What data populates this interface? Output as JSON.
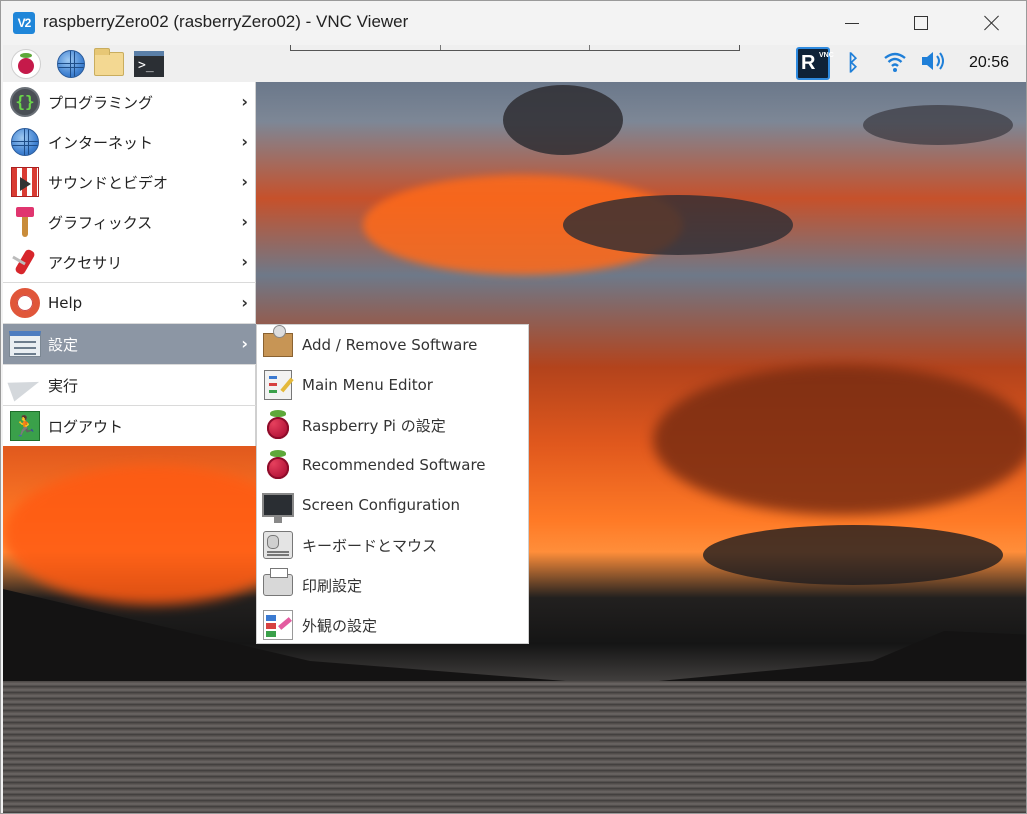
{
  "window": {
    "title": "raspberryZero02 (rasberryZero02) - VNC Viewer",
    "app_icon_text": "V2"
  },
  "taskbar": {
    "clock": "20:56",
    "vnc_tray_letter": "R",
    "vnc_tray_small": "VNC",
    "icons": [
      "raspberry-menu-icon",
      "web-browser-icon",
      "file-manager-icon",
      "terminal-icon"
    ],
    "terminal_glyph": ">_"
  },
  "menu": {
    "items": [
      {
        "label": "プログラミング",
        "icon": "programming-icon",
        "has_submenu": true
      },
      {
        "label": "インターネット",
        "icon": "internet-icon",
        "has_submenu": true
      },
      {
        "label": "サウンドとビデオ",
        "icon": "sound-video-icon",
        "has_submenu": true
      },
      {
        "label": "グラフィックス",
        "icon": "graphics-icon",
        "has_submenu": true
      },
      {
        "label": "アクセサリ",
        "icon": "accessories-icon",
        "has_submenu": true
      },
      {
        "label": "Help",
        "icon": "help-icon",
        "has_submenu": true
      },
      {
        "label": "設定",
        "icon": "settings-icon",
        "has_submenu": true,
        "active": true
      },
      {
        "label": "実行",
        "icon": "run-icon",
        "has_submenu": false
      },
      {
        "label": "ログアウト",
        "icon": "logout-icon",
        "has_submenu": false
      }
    ],
    "arrow": "›"
  },
  "submenu": {
    "items": [
      {
        "label": "Add / Remove Software",
        "icon": "package-icon"
      },
      {
        "label": "Main Menu Editor",
        "icon": "menu-editor-icon"
      },
      {
        "label": "Raspberry Pi の設定",
        "icon": "raspberry-pi-icon"
      },
      {
        "label": "Recommended Software",
        "icon": "raspberry-pi-icon"
      },
      {
        "label": "Screen Configuration",
        "icon": "monitor-icon"
      },
      {
        "label": "キーボードとマウス",
        "icon": "keyboard-mouse-icon"
      },
      {
        "label": "印刷設定",
        "icon": "printer-icon"
      },
      {
        "label": "外観の設定",
        "icon": "appearance-icon"
      }
    ]
  },
  "colors": {
    "menu_active": "#8c96a4",
    "accent": "#1f7fd8"
  }
}
